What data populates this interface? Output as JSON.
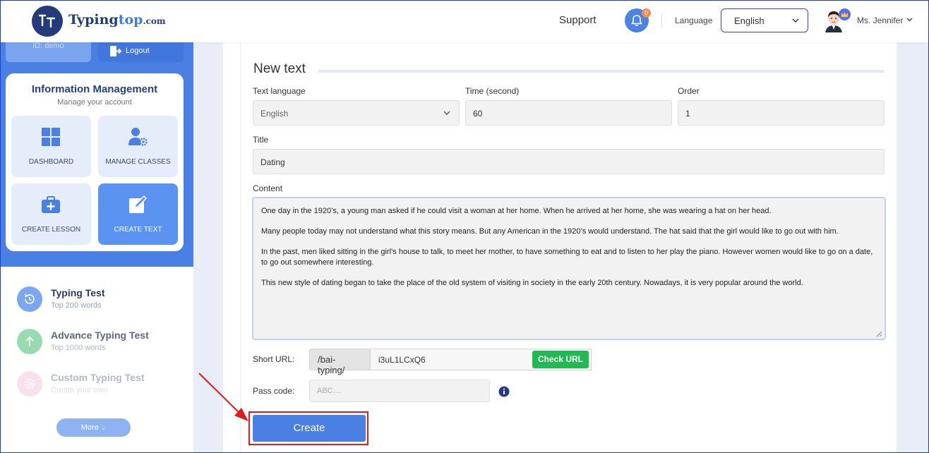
{
  "header": {
    "logo_main": "Typing",
    "logo_accent": "top",
    "logo_suffix": ".com",
    "support": "Support",
    "notification_count": "0",
    "language_label": "Language",
    "language_value": "English",
    "user_name": "Ms. Jennifer"
  },
  "sidebar": {
    "id_label": "ID: demo",
    "logout": "Logout",
    "info_title": "Information Management",
    "info_subtitle": "Manage your account",
    "tiles": [
      {
        "label": "DASHBOARD",
        "icon": "grid-icon"
      },
      {
        "label": "MANAGE CLASSES",
        "icon": "user-gear-icon"
      },
      {
        "label": "CREATE LESSON",
        "icon": "briefcase-plus-icon"
      },
      {
        "label": "CREATE TEXT",
        "icon": "edit-icon",
        "active": true
      }
    ],
    "nav": [
      {
        "title": "Typing Test",
        "subtitle": "Top 200 words"
      },
      {
        "title": "Advance Typing Test",
        "subtitle": "Top 1000 words"
      },
      {
        "title": "Custom Typing Test",
        "subtitle": "Create your own"
      }
    ],
    "more": "More"
  },
  "form": {
    "section_title": "New text",
    "text_language_label": "Text language",
    "text_language_value": "English",
    "time_label": "Time (second)",
    "time_value": "60",
    "order_label": "Order",
    "order_value": "1",
    "title_label": "Title",
    "title_value": "Dating",
    "content_label": "Content",
    "content_paragraphs": [
      "One day in the 1920’s, a young man asked if he could visit a woman at her home. When he arrived at her home, she was wearing a hat on her head.",
      "Many people today may not understand what this story means. But any American in the 1920’s would understand. The hat said that the girl would like to go out with him.",
      "In the past, men liked sitting in the girl’s house to talk, to meet her mother, to have something to eat and to listen to her play the piano. However women would like to go on a date, to go out somewhere interesting.",
      "This new style of dating began to take the place of the old system of visiting in society in the early 20th century. Nowadays, it is very popular around the world."
    ],
    "short_url_label": "Short URL:",
    "short_url_prefix": "/bai-typing/",
    "short_url_value": "i3uL1LCxQ6",
    "check_url": "Check URL",
    "pass_code_label": "Pass code:",
    "pass_code_placeholder": "ABC....",
    "create": "Create"
  },
  "colors": {
    "primary": "#4a7fe3",
    "navy": "#243b7b",
    "green": "#1fba52",
    "highlight_red": "#e01b1b"
  }
}
